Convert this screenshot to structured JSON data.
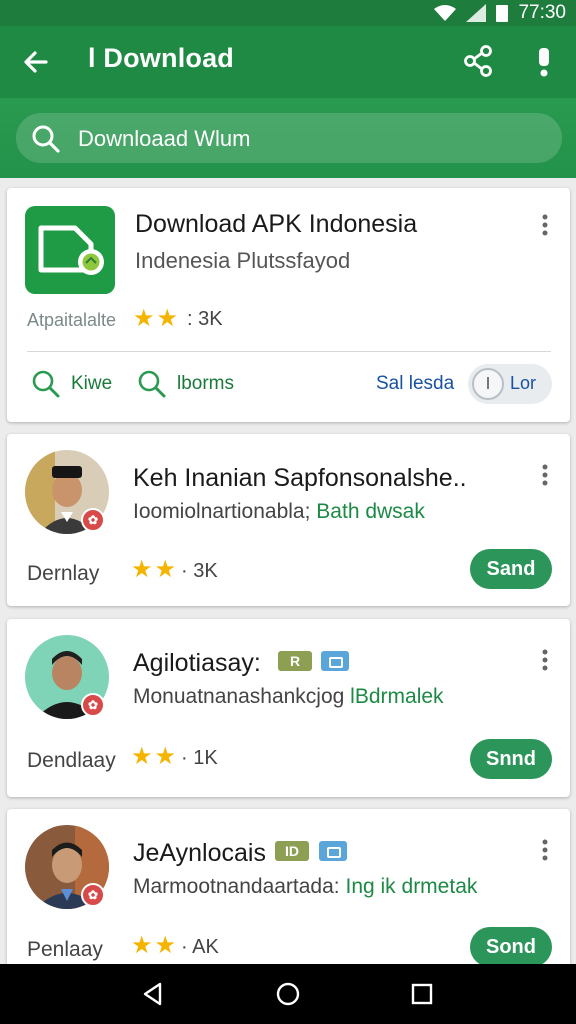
{
  "status": {
    "time": "77:30"
  },
  "appbar": {
    "title": "l Download"
  },
  "search": {
    "text": "Downloaad Wlum"
  },
  "featured": {
    "title": "Download APK Indonesia",
    "subtitle": "Indenesia Plutssfayod",
    "meta_label": "Atpaitalalte",
    "rating": 2,
    "count": "3K",
    "actions": {
      "kiwe": "Kiwe",
      "iborms": "lborms",
      "sales": "Sal lesda",
      "toggle": "Lor"
    }
  },
  "items": [
    {
      "title": "Keh Inanian Sapfonsonalshe..",
      "subtitle_prefix": "Ioomiolnartionabla;",
      "subtitle_accent": "Bath dwsak",
      "label": "Dernlay",
      "rating": 2,
      "count": "3K",
      "action": "Sand"
    },
    {
      "title": "Agilotiasay:",
      "badge": "R",
      "subtitle_prefix": "Monuatnanashankcjog",
      "subtitle_accent": "lBdrmalek",
      "label": "Dendlaay",
      "rating": 2,
      "count": "1K",
      "action": "Snnd"
    },
    {
      "title": "JeAynlocais",
      "badge": "ID",
      "subtitle_prefix": "Marmootnandaartada:",
      "subtitle_accent": "Ing ik drmetak",
      "label": "Penlaay",
      "rating": 2,
      "count": "AK",
      "action": "Sond"
    }
  ],
  "colors": {
    "primary": "#1f8a44",
    "accent": "#2b955a",
    "star": "#f4b400"
  }
}
